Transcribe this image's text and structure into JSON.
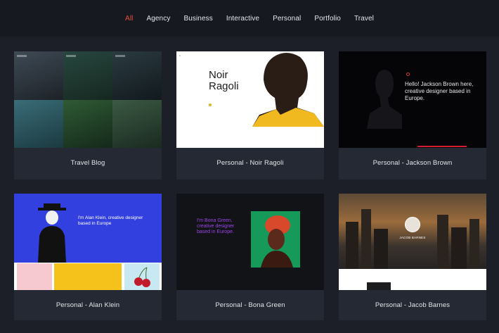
{
  "filters": [
    {
      "label": "All",
      "active": true
    },
    {
      "label": "Agency",
      "active": false
    },
    {
      "label": "Business",
      "active": false
    },
    {
      "label": "Interactive",
      "active": false
    },
    {
      "label": "Personal",
      "active": false
    },
    {
      "label": "Portfolio",
      "active": false
    },
    {
      "label": "Travel",
      "active": false
    }
  ],
  "cards": [
    {
      "caption": "Travel Blog"
    },
    {
      "caption": "Personal - Noir Ragoli"
    },
    {
      "caption": "Personal - Jackson Brown"
    },
    {
      "caption": "Personal - Alan Klein"
    },
    {
      "caption": "Personal - Bona Green"
    },
    {
      "caption": "Personal - Jacob Barnes"
    }
  ],
  "previews": {
    "noir": {
      "name_line1": "Noir",
      "name_line2": "Ragoli"
    },
    "jackson": {
      "headline": "Hello! Jackson Brown here, creative designer based in Europe."
    },
    "alan": {
      "headline": "I'm Alan Klein, creative designer based in Europe"
    },
    "bona": {
      "headline": "I'm Bona Green, creative designer based in Europe."
    },
    "jacob": {
      "name": "JACOB BARNES"
    }
  },
  "colors": {
    "accent": "#e94e3c",
    "background": "#1c1f27",
    "card": "#252933"
  }
}
